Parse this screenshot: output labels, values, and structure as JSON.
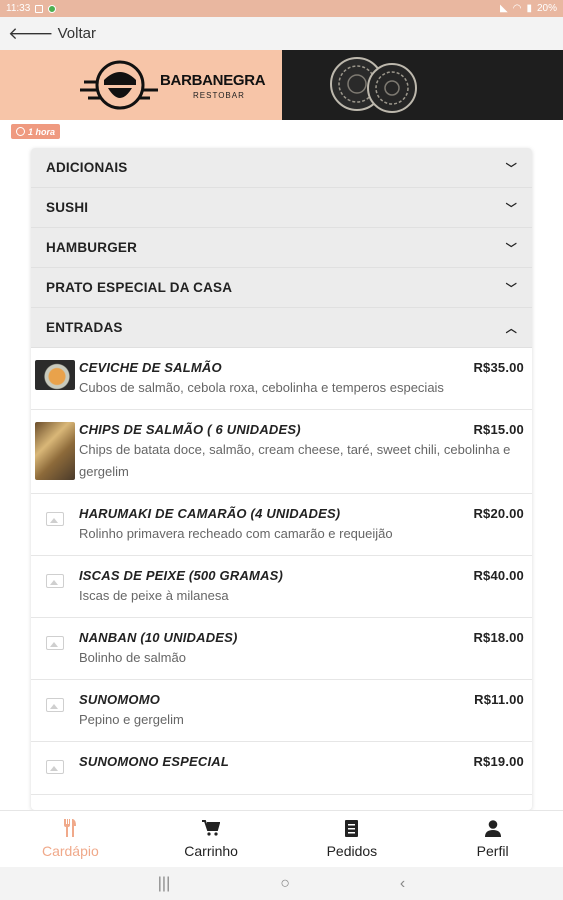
{
  "status_bar": {
    "time": "11:33",
    "battery": "20%"
  },
  "header": {
    "back_label": "Voltar"
  },
  "banner": {
    "brand": "BARBANEGRA",
    "tagline": "RESTOBAR"
  },
  "badge": {
    "time_text": "1 hora"
  },
  "categories": [
    {
      "label": "ADICIONAIS",
      "chevron": "chevron-down-icon"
    },
    {
      "label": "SUSHI",
      "chevron": "chevron-down-icon"
    },
    {
      "label": "HAMBURGER",
      "chevron": "chevron-down-icon"
    },
    {
      "label": "PRATO ESPECIAL DA CASA",
      "chevron": "chevron-down-icon"
    },
    {
      "label": "ENTRADAS",
      "chevron": "chevron-up-icon"
    }
  ],
  "items": [
    {
      "name": "CEVICHE DE SALMÃO",
      "price": "R$35.00",
      "description": "Cubos de salmão, cebola roxa, cebolinha e temperos especiais",
      "image": "ceviche-photo"
    },
    {
      "name": "CHIPS DE SALMÃO ( 6 UNIDADES)",
      "price": "R$15.00",
      "description": "Chips de batata doce, salmão, cream cheese, taré, sweet chili, cebolinha e gergelim",
      "image": "chips-photo"
    },
    {
      "name": "HARUMAKI DE CAMARÃO (4 UNIDADES)",
      "price": "R$20.00",
      "description": "Rolinho primavera recheado com camarão e requeijão",
      "image": "image-placeholder-icon"
    },
    {
      "name": "ISCAS DE PEIXE (500 GRAMAS)",
      "price": "R$40.00",
      "description": "Iscas de peixe à milanesa",
      "image": "image-placeholder-icon"
    },
    {
      "name": "NANBAN (10 UNIDADES)",
      "price": "R$18.00",
      "description": "Bolinho de salmão",
      "image": "image-placeholder-icon"
    },
    {
      "name": "SUNOMOMO",
      "price": "R$11.00",
      "description": "Pepino e gergelim",
      "image": "image-placeholder-icon"
    },
    {
      "name": "SUNOMONO ESPECIAL",
      "price": "R$19.00",
      "description": "",
      "image": "image-placeholder-icon"
    }
  ],
  "bottom_nav": [
    {
      "label": "Cardápio",
      "icon": "utensils-icon",
      "active": true
    },
    {
      "label": "Carrinho",
      "icon": "cart-icon",
      "active": false
    },
    {
      "label": "Pedidos",
      "icon": "receipt-icon",
      "active": false
    },
    {
      "label": "Perfil",
      "icon": "user-icon",
      "active": false
    }
  ],
  "colors": {
    "accent": "#f0a98a",
    "status_bar": "#e9b7a0",
    "banner_left": "#f7c5a8",
    "badge": "#ef9a80"
  }
}
